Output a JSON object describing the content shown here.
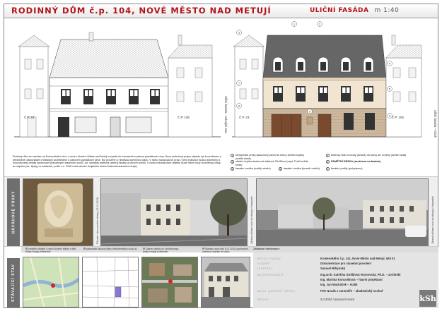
{
  "header": {
    "title": "RODINNÝ DŮM č.p. 104, NOVÉ MĚSTO NAD METUJÍ",
    "view_title": "ULIČNÍ FASÁDA",
    "scale": "m 1:40"
  },
  "drawings": {
    "left_number_a": "Č.P. 23",
    "left_number_b": "Č.P. 105",
    "right_number_a": "Č.P. 23",
    "right_number_b": "Č.P. 105",
    "left_vertical_label": "Uliční fasáda – stávající stav",
    "right_vertical_label": "Uliční fasáda – návrh",
    "marker_labels": [
      "1",
      "2",
      "3",
      "4",
      "5",
      "6",
      "7",
      "8",
      "9"
    ]
  },
  "description": "Rodinný dům se nachází na Komenského ulici, v centru Nového Města nad Metují a spadá do ochranného pásma památkové zóny. Nový vzhledový projev objektu byl konzultován a předběžně odsouhlasen městským architektem a odborem památkové péče. Byl prověřen z hlediska územního plánu. V rámci navazujících prací / před realizací budou dokreslny a konzultovány detaily zpracování jednotlivých fasádních prvků, zvl. kontakty barevná odstíny fasády a uličních prvků. V rámci rekonstrukce objektu bude řešen nový (rozšířený) vstup do objektu (viz. šipky) ve zástavbě, podle z.č. 2018 rozhodnutím Krajského úřadu Královéhradeckého kraje).",
  "legend": [
    {
      "n": "1",
      "text": "klempířské prvky-fasucnový plech do barvy střešní krytiny (světle šedá)"
    },
    {
      "n": "2",
      "text": "dešťový žlab a svody (tu/sed) do barvy stř. krytiny (světle šedá)"
    },
    {
      "n": "3",
      "text": "střešní krytina-betonová tašková 29x33cm (např. Profil světle šedá)"
    },
    {
      "n": "4",
      "text": "PAMĚTNÍ DESKA (zavěšena na fasádu)"
    },
    {
      "n": "5",
      "text": "fasádní omítka (světlý odstín)"
    },
    {
      "n": "6",
      "text": "fasádní omítka (tmavší odstín)"
    },
    {
      "n": "7",
      "text": "fasádní profily (polystyren)"
    }
  ],
  "band_label": "NÁVRHOVÉ PRVKY",
  "bottom_label": "STÁVAJÍCÍ STAV",
  "photo_captions": [
    "Původní stav pamětní desky (12.12.2021)",
    "Zdravá uličkami ulicí do stávající fotografie",
    "Zdravá uličkami ulicí do stávající fotografie"
  ],
  "map_captions": [
    "umístění objektu v rámci Nového Města n Met. (https://mapy.cz/letecké)",
    "katastrální situace (https://nahlizenidokn.cuzk.cz)",
    "Zákres objektu do ortofotomapy (https://mapy.cz/letecké)",
    "Stávající stav (foto 8.11.2021) (pohledová orientace objektu do ulice)"
  ],
  "info": {
    "heading": "Základní informace:",
    "rows": [
      {
        "k": "místo stavby:",
        "v": "Komenského č.p. 141, Nové Město nad Metují, 549 01",
        "bold": true
      },
      {
        "k": "stupeň:",
        "v": "Dokumentace pro stavební povolení",
        "bold": true
      },
      {
        "k": "investor:",
        "v": "Samuel Mihýnský",
        "bold": true
      },
      {
        "k": "autorka/autoři:",
        "v": "Ing.arch. Kateřina Stréblová Hronovská, Ph.D. – architekt",
        "bold": true
      },
      {
        "k": "",
        "v": "Ing. Martina Koncošková – hlavní projektant",
        "bold": true
      },
      {
        "k": "",
        "v": "Ing. Jan Macháček – statik",
        "bold": true
      },
      {
        "k": "autor pamětní desky:",
        "v": "Petr Novák z Jaroměře – akademický sochař",
        "bold": true
      },
      {
        "k": "datum:",
        "v": "3.4.2022 / pracovní revize",
        "bold": false
      }
    ]
  },
  "logo_text": "kSh"
}
